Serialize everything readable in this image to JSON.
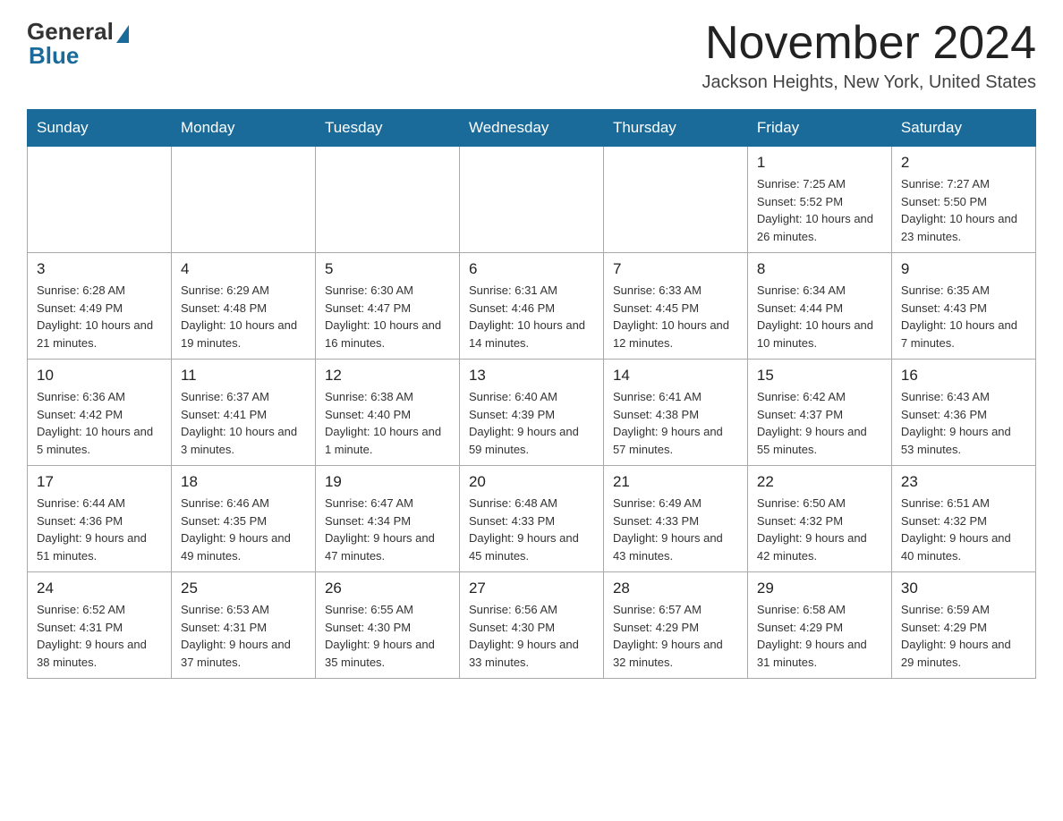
{
  "logo": {
    "general": "General",
    "blue": "Blue"
  },
  "title": {
    "month": "November 2024",
    "location": "Jackson Heights, New York, United States"
  },
  "weekdays": [
    "Sunday",
    "Monday",
    "Tuesday",
    "Wednesday",
    "Thursday",
    "Friday",
    "Saturday"
  ],
  "weeks": [
    [
      {
        "day": "",
        "info": ""
      },
      {
        "day": "",
        "info": ""
      },
      {
        "day": "",
        "info": ""
      },
      {
        "day": "",
        "info": ""
      },
      {
        "day": "",
        "info": ""
      },
      {
        "day": "1",
        "info": "Sunrise: 7:25 AM\nSunset: 5:52 PM\nDaylight: 10 hours and 26 minutes."
      },
      {
        "day": "2",
        "info": "Sunrise: 7:27 AM\nSunset: 5:50 PM\nDaylight: 10 hours and 23 minutes."
      }
    ],
    [
      {
        "day": "3",
        "info": "Sunrise: 6:28 AM\nSunset: 4:49 PM\nDaylight: 10 hours and 21 minutes."
      },
      {
        "day": "4",
        "info": "Sunrise: 6:29 AM\nSunset: 4:48 PM\nDaylight: 10 hours and 19 minutes."
      },
      {
        "day": "5",
        "info": "Sunrise: 6:30 AM\nSunset: 4:47 PM\nDaylight: 10 hours and 16 minutes."
      },
      {
        "day": "6",
        "info": "Sunrise: 6:31 AM\nSunset: 4:46 PM\nDaylight: 10 hours and 14 minutes."
      },
      {
        "day": "7",
        "info": "Sunrise: 6:33 AM\nSunset: 4:45 PM\nDaylight: 10 hours and 12 minutes."
      },
      {
        "day": "8",
        "info": "Sunrise: 6:34 AM\nSunset: 4:44 PM\nDaylight: 10 hours and 10 minutes."
      },
      {
        "day": "9",
        "info": "Sunrise: 6:35 AM\nSunset: 4:43 PM\nDaylight: 10 hours and 7 minutes."
      }
    ],
    [
      {
        "day": "10",
        "info": "Sunrise: 6:36 AM\nSunset: 4:42 PM\nDaylight: 10 hours and 5 minutes."
      },
      {
        "day": "11",
        "info": "Sunrise: 6:37 AM\nSunset: 4:41 PM\nDaylight: 10 hours and 3 minutes."
      },
      {
        "day": "12",
        "info": "Sunrise: 6:38 AM\nSunset: 4:40 PM\nDaylight: 10 hours and 1 minute."
      },
      {
        "day": "13",
        "info": "Sunrise: 6:40 AM\nSunset: 4:39 PM\nDaylight: 9 hours and 59 minutes."
      },
      {
        "day": "14",
        "info": "Sunrise: 6:41 AM\nSunset: 4:38 PM\nDaylight: 9 hours and 57 minutes."
      },
      {
        "day": "15",
        "info": "Sunrise: 6:42 AM\nSunset: 4:37 PM\nDaylight: 9 hours and 55 minutes."
      },
      {
        "day": "16",
        "info": "Sunrise: 6:43 AM\nSunset: 4:36 PM\nDaylight: 9 hours and 53 minutes."
      }
    ],
    [
      {
        "day": "17",
        "info": "Sunrise: 6:44 AM\nSunset: 4:36 PM\nDaylight: 9 hours and 51 minutes."
      },
      {
        "day": "18",
        "info": "Sunrise: 6:46 AM\nSunset: 4:35 PM\nDaylight: 9 hours and 49 minutes."
      },
      {
        "day": "19",
        "info": "Sunrise: 6:47 AM\nSunset: 4:34 PM\nDaylight: 9 hours and 47 minutes."
      },
      {
        "day": "20",
        "info": "Sunrise: 6:48 AM\nSunset: 4:33 PM\nDaylight: 9 hours and 45 minutes."
      },
      {
        "day": "21",
        "info": "Sunrise: 6:49 AM\nSunset: 4:33 PM\nDaylight: 9 hours and 43 minutes."
      },
      {
        "day": "22",
        "info": "Sunrise: 6:50 AM\nSunset: 4:32 PM\nDaylight: 9 hours and 42 minutes."
      },
      {
        "day": "23",
        "info": "Sunrise: 6:51 AM\nSunset: 4:32 PM\nDaylight: 9 hours and 40 minutes."
      }
    ],
    [
      {
        "day": "24",
        "info": "Sunrise: 6:52 AM\nSunset: 4:31 PM\nDaylight: 9 hours and 38 minutes."
      },
      {
        "day": "25",
        "info": "Sunrise: 6:53 AM\nSunset: 4:31 PM\nDaylight: 9 hours and 37 minutes."
      },
      {
        "day": "26",
        "info": "Sunrise: 6:55 AM\nSunset: 4:30 PM\nDaylight: 9 hours and 35 minutes."
      },
      {
        "day": "27",
        "info": "Sunrise: 6:56 AM\nSunset: 4:30 PM\nDaylight: 9 hours and 33 minutes."
      },
      {
        "day": "28",
        "info": "Sunrise: 6:57 AM\nSunset: 4:29 PM\nDaylight: 9 hours and 32 minutes."
      },
      {
        "day": "29",
        "info": "Sunrise: 6:58 AM\nSunset: 4:29 PM\nDaylight: 9 hours and 31 minutes."
      },
      {
        "day": "30",
        "info": "Sunrise: 6:59 AM\nSunset: 4:29 PM\nDaylight: 9 hours and 29 minutes."
      }
    ]
  ]
}
